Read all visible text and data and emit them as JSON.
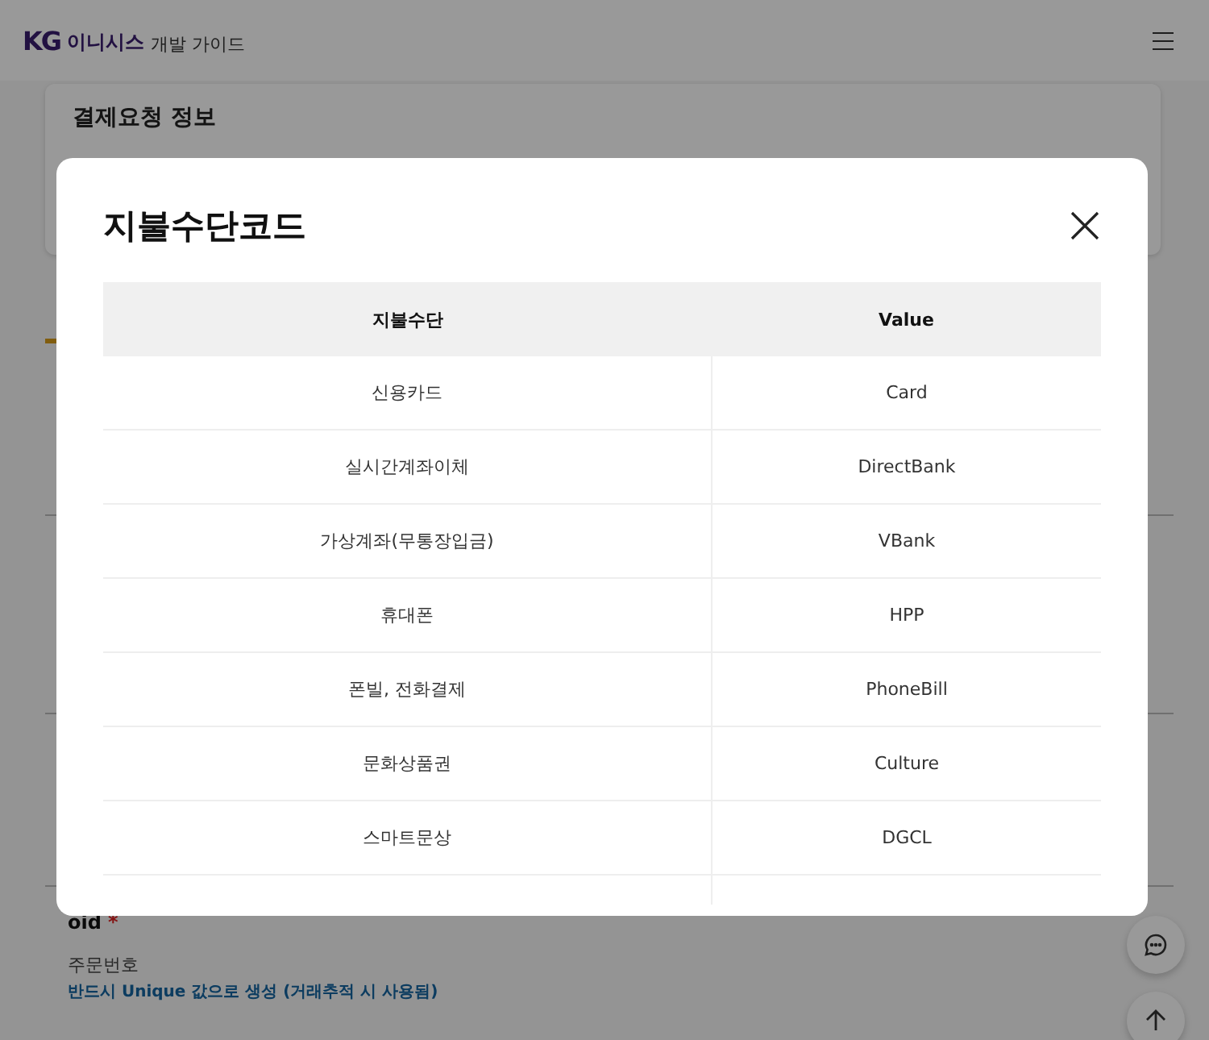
{
  "header": {
    "logo_mark": "KG",
    "logo_name": "이니시스",
    "subtitle": "개발 가이드"
  },
  "card": {
    "title": "결제요청 정보"
  },
  "field": {
    "name": "oid",
    "required_mark": "*",
    "description": "주문번호",
    "note": "반드시 Unique 값으로 생성 (거래추적 시 사용됨)"
  },
  "modal": {
    "title": "지불수단코드",
    "columns": [
      "지불수단",
      "Value"
    ],
    "rows": [
      [
        "신용카드",
        "Card"
      ],
      [
        "실시간계좌이체",
        "DirectBank"
      ],
      [
        "가상계좌(무통장입금)",
        "VBank"
      ],
      [
        "휴대폰",
        "HPP"
      ],
      [
        "폰빌, 전화결제",
        "PhoneBill"
      ],
      [
        "문화상품권",
        "Culture"
      ],
      [
        "스마트문상",
        "DGCL"
      ]
    ]
  }
}
